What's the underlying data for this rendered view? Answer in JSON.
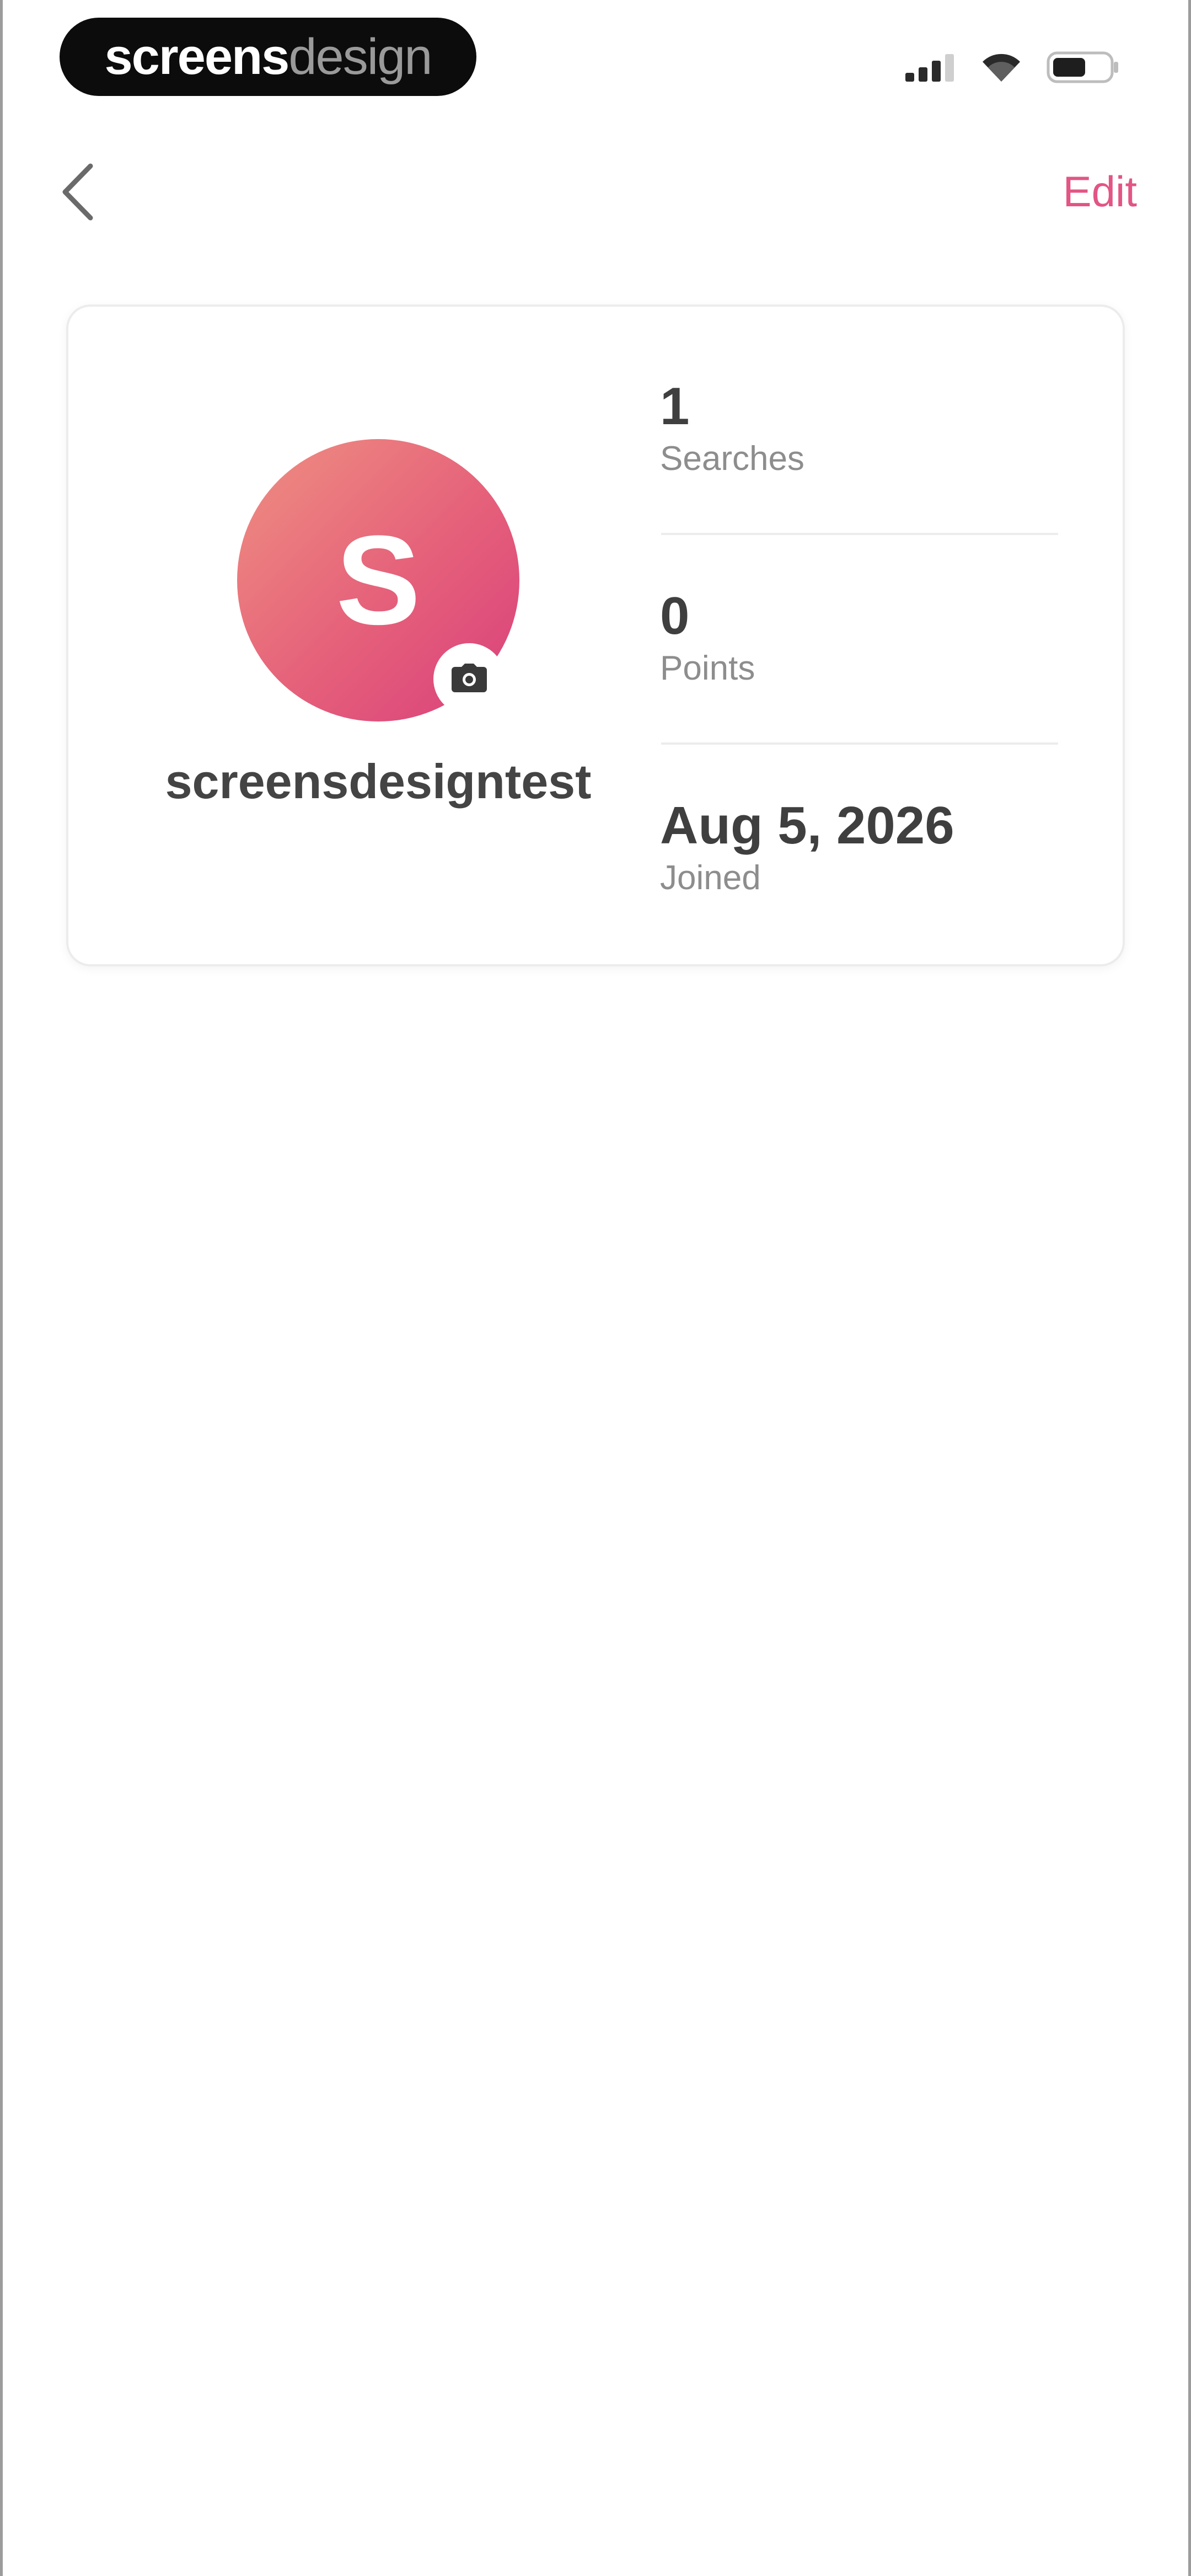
{
  "status_bar": {
    "brand_bold": "screens",
    "brand_light": "design",
    "icons": [
      "cellular-signal-icon",
      "wifi-icon",
      "battery-icon"
    ]
  },
  "nav": {
    "back_icon": "chevron-left-icon",
    "edit_label": "Edit"
  },
  "profile": {
    "avatar_initial": "S",
    "username": "screensdesigntest",
    "camera_icon": "camera-icon"
  },
  "stats": [
    {
      "value": "1",
      "label": "Searches"
    },
    {
      "value": "0",
      "label": "Points"
    },
    {
      "value": "Aug 5, 2026",
      "label": "Joined"
    }
  ],
  "colors": {
    "accent": "#e25584",
    "avatar_gradient_start": "#ef9082",
    "avatar_gradient_end": "#d93f7c"
  }
}
